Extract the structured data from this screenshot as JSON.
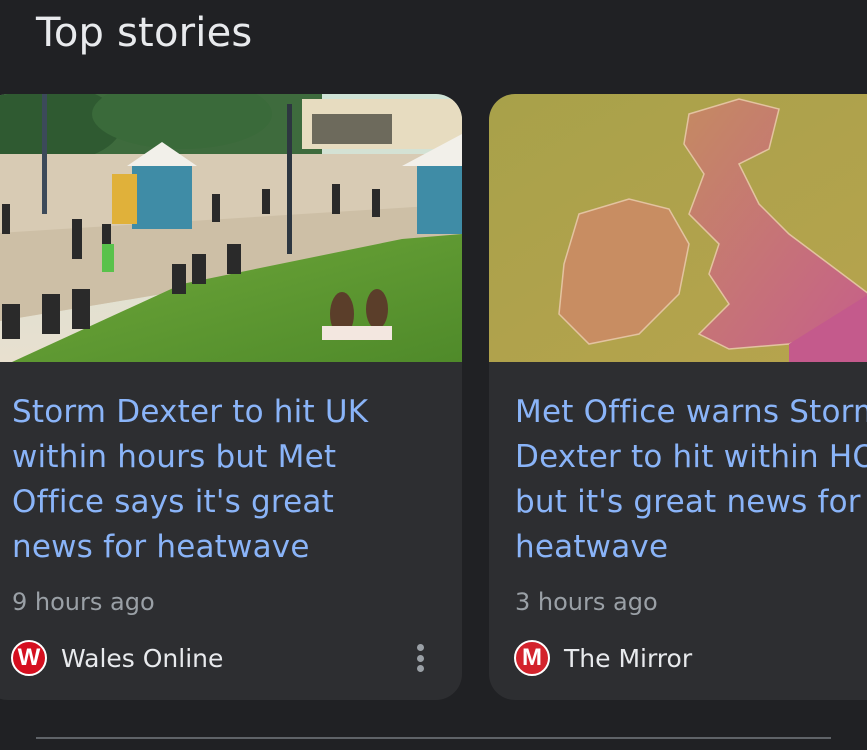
{
  "section": {
    "title": "Top stories"
  },
  "stories": [
    {
      "headline": "Storm Dexter to hit UK within hours but Met Office says it's great news for heatwave",
      "time": "9 hours ago",
      "source": "Wales Online",
      "logo_letter": "W",
      "logo_color": "#d50f1f",
      "image": "beach-promenade-photo"
    },
    {
      "headline": "Met Office warns Storm Dexter to hit within HOURS but it's great news for heatwave",
      "time": "3 hours ago",
      "source": "The Mirror",
      "logo_letter": "M",
      "logo_color": "#d3232c",
      "image": "uk-temperature-map"
    }
  ],
  "colors": {
    "background": "#202124",
    "card": "#2d2e31",
    "headline": "#8ab4f8",
    "meta": "#9aa0a6",
    "text": "#e8eaed"
  }
}
